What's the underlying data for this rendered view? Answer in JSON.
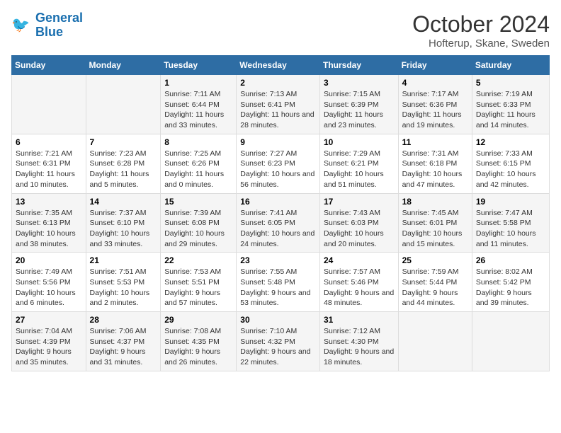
{
  "logo": {
    "line1": "General",
    "line2": "Blue"
  },
  "title": "October 2024",
  "location": "Hofterup, Skane, Sweden",
  "days_of_week": [
    "Sunday",
    "Monday",
    "Tuesday",
    "Wednesday",
    "Thursday",
    "Friday",
    "Saturday"
  ],
  "weeks": [
    [
      {
        "day": null
      },
      {
        "day": null
      },
      {
        "day": "1",
        "sunrise": "7:11 AM",
        "sunset": "6:44 PM",
        "daylight": "11 hours and 33 minutes."
      },
      {
        "day": "2",
        "sunrise": "7:13 AM",
        "sunset": "6:41 PM",
        "daylight": "11 hours and 28 minutes."
      },
      {
        "day": "3",
        "sunrise": "7:15 AM",
        "sunset": "6:39 PM",
        "daylight": "11 hours and 23 minutes."
      },
      {
        "day": "4",
        "sunrise": "7:17 AM",
        "sunset": "6:36 PM",
        "daylight": "11 hours and 19 minutes."
      },
      {
        "day": "5",
        "sunrise": "7:19 AM",
        "sunset": "6:33 PM",
        "daylight": "11 hours and 14 minutes."
      }
    ],
    [
      {
        "day": "6",
        "sunrise": "7:21 AM",
        "sunset": "6:31 PM",
        "daylight": "11 hours and 10 minutes."
      },
      {
        "day": "7",
        "sunrise": "7:23 AM",
        "sunset": "6:28 PM",
        "daylight": "11 hours and 5 minutes."
      },
      {
        "day": "8",
        "sunrise": "7:25 AM",
        "sunset": "6:26 PM",
        "daylight": "11 hours and 0 minutes."
      },
      {
        "day": "9",
        "sunrise": "7:27 AM",
        "sunset": "6:23 PM",
        "daylight": "10 hours and 56 minutes."
      },
      {
        "day": "10",
        "sunrise": "7:29 AM",
        "sunset": "6:21 PM",
        "daylight": "10 hours and 51 minutes."
      },
      {
        "day": "11",
        "sunrise": "7:31 AM",
        "sunset": "6:18 PM",
        "daylight": "10 hours and 47 minutes."
      },
      {
        "day": "12",
        "sunrise": "7:33 AM",
        "sunset": "6:15 PM",
        "daylight": "10 hours and 42 minutes."
      }
    ],
    [
      {
        "day": "13",
        "sunrise": "7:35 AM",
        "sunset": "6:13 PM",
        "daylight": "10 hours and 38 minutes."
      },
      {
        "day": "14",
        "sunrise": "7:37 AM",
        "sunset": "6:10 PM",
        "daylight": "10 hours and 33 minutes."
      },
      {
        "day": "15",
        "sunrise": "7:39 AM",
        "sunset": "6:08 PM",
        "daylight": "10 hours and 29 minutes."
      },
      {
        "day": "16",
        "sunrise": "7:41 AM",
        "sunset": "6:05 PM",
        "daylight": "10 hours and 24 minutes."
      },
      {
        "day": "17",
        "sunrise": "7:43 AM",
        "sunset": "6:03 PM",
        "daylight": "10 hours and 20 minutes."
      },
      {
        "day": "18",
        "sunrise": "7:45 AM",
        "sunset": "6:01 PM",
        "daylight": "10 hours and 15 minutes."
      },
      {
        "day": "19",
        "sunrise": "7:47 AM",
        "sunset": "5:58 PM",
        "daylight": "10 hours and 11 minutes."
      }
    ],
    [
      {
        "day": "20",
        "sunrise": "7:49 AM",
        "sunset": "5:56 PM",
        "daylight": "10 hours and 6 minutes."
      },
      {
        "day": "21",
        "sunrise": "7:51 AM",
        "sunset": "5:53 PM",
        "daylight": "10 hours and 2 minutes."
      },
      {
        "day": "22",
        "sunrise": "7:53 AM",
        "sunset": "5:51 PM",
        "daylight": "9 hours and 57 minutes."
      },
      {
        "day": "23",
        "sunrise": "7:55 AM",
        "sunset": "5:48 PM",
        "daylight": "9 hours and 53 minutes."
      },
      {
        "day": "24",
        "sunrise": "7:57 AM",
        "sunset": "5:46 PM",
        "daylight": "9 hours and 48 minutes."
      },
      {
        "day": "25",
        "sunrise": "7:59 AM",
        "sunset": "5:44 PM",
        "daylight": "9 hours and 44 minutes."
      },
      {
        "day": "26",
        "sunrise": "8:02 AM",
        "sunset": "5:42 PM",
        "daylight": "9 hours and 39 minutes."
      }
    ],
    [
      {
        "day": "27",
        "sunrise": "7:04 AM",
        "sunset": "4:39 PM",
        "daylight": "9 hours and 35 minutes."
      },
      {
        "day": "28",
        "sunrise": "7:06 AM",
        "sunset": "4:37 PM",
        "daylight": "9 hours and 31 minutes."
      },
      {
        "day": "29",
        "sunrise": "7:08 AM",
        "sunset": "4:35 PM",
        "daylight": "9 hours and 26 minutes."
      },
      {
        "day": "30",
        "sunrise": "7:10 AM",
        "sunset": "4:32 PM",
        "daylight": "9 hours and 22 minutes."
      },
      {
        "day": "31",
        "sunrise": "7:12 AM",
        "sunset": "4:30 PM",
        "daylight": "9 hours and 18 minutes."
      },
      {
        "day": null
      },
      {
        "day": null
      }
    ]
  ],
  "labels": {
    "sunrise_prefix": "Sunrise: ",
    "sunset_prefix": "Sunset: ",
    "daylight_prefix": "Daylight: "
  }
}
